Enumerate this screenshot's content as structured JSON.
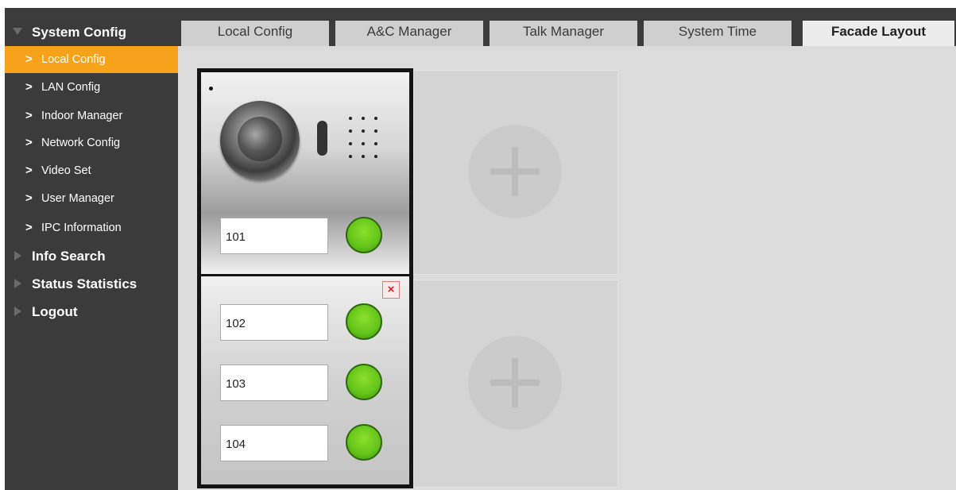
{
  "sidebar": {
    "groups": [
      {
        "label": "System Config"
      },
      {
        "label": "Info Search"
      },
      {
        "label": "Status Statistics"
      },
      {
        "label": "Logout"
      }
    ],
    "items": [
      {
        "label": "Local Config",
        "active": true
      },
      {
        "label": "LAN Config"
      },
      {
        "label": "Indoor Manager"
      },
      {
        "label": "Network Config"
      },
      {
        "label": "Video Set"
      },
      {
        "label": "User Manager"
      },
      {
        "label": "IPC Information"
      }
    ],
    "chevron": ">"
  },
  "tabs": [
    {
      "label": "Local Config"
    },
    {
      "label": "A&C Manager"
    },
    {
      "label": "Talk Manager"
    },
    {
      "label": "System Time"
    },
    {
      "label": "Facade Layout",
      "active": true
    }
  ],
  "facade": {
    "module1": {
      "rooms": [
        "101"
      ]
    },
    "module2": {
      "rooms": [
        "102",
        "103",
        "104"
      ],
      "delete_label": "×"
    }
  },
  "colors": {
    "sidebar_bg": "#3b3b3b",
    "active_item": "#f7a21b",
    "call_button": "#62c31a",
    "content_bg": "#dbdbdb"
  },
  "icons": {
    "expand": "triangle-down-icon",
    "collapsed": "triangle-right-icon",
    "add_module": "plus-icon",
    "delete_module": "close-icon"
  }
}
